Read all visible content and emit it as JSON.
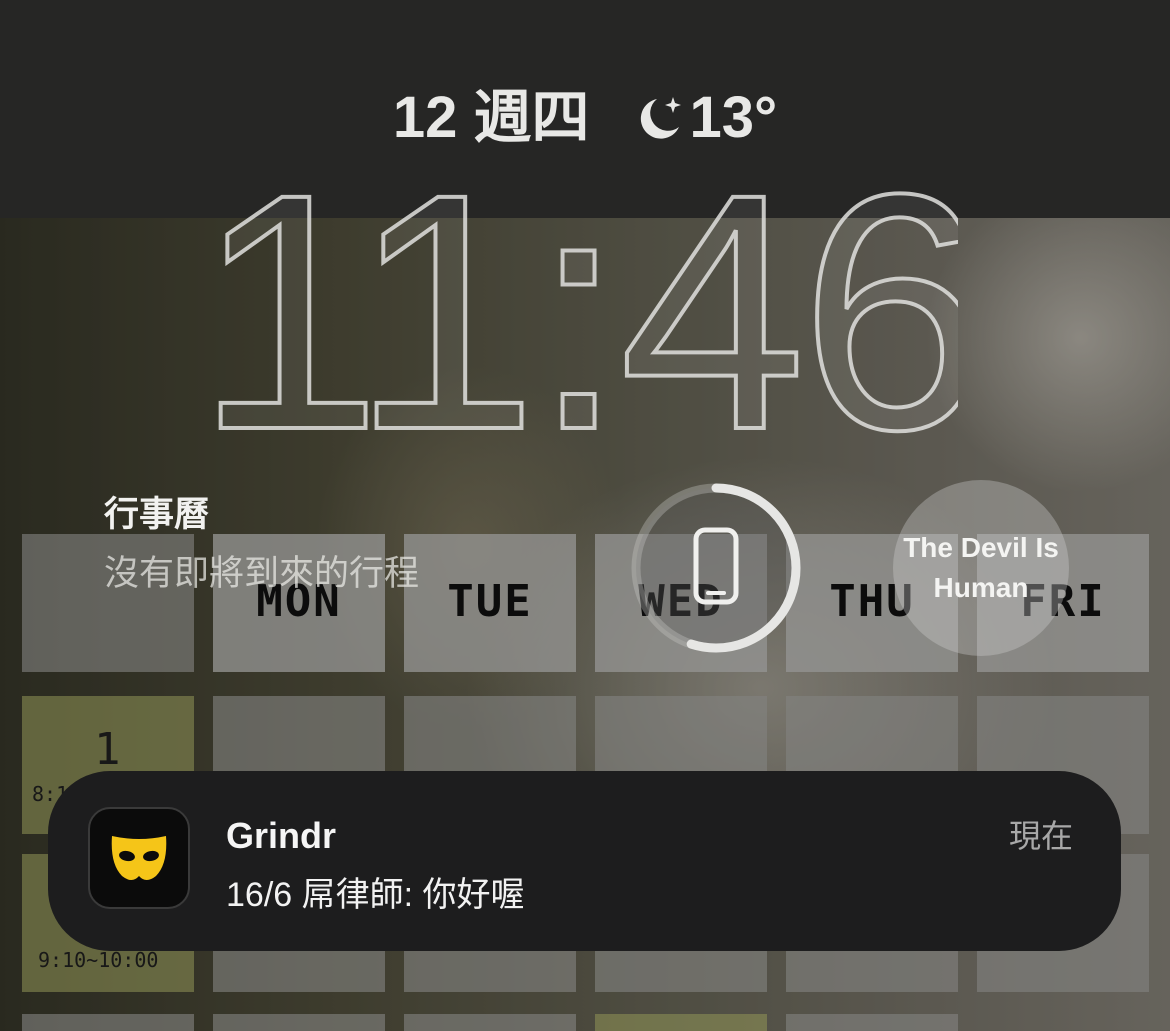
{
  "status": {
    "date": "12 週四",
    "weather_icon": "moon-stars-icon",
    "temperature": "13°"
  },
  "clock": {
    "time": "11:46"
  },
  "calendar_widget": {
    "title": "行事曆",
    "subtitle": "沒有即將到來的行程"
  },
  "battery_widget": {
    "icon": "iphone-icon",
    "level": 0.55
  },
  "music_widget": {
    "title": "The Devil Is Human"
  },
  "wallpaper": {
    "days": [
      "MON",
      "TUE",
      "WED",
      "THU",
      "FRI"
    ],
    "period_number": "1",
    "period_time_top": "8:10",
    "period_time_bottom": "9:10~10:00"
  },
  "notification": {
    "app_icon": "grindr-mask-icon",
    "app": "Grindr",
    "message": "16/6 屌律師: 你好喔",
    "time": "現在"
  },
  "colors": {
    "background": "#262625",
    "notification_bg": "#1d1d1e",
    "grindr_yellow": "#f5c518"
  }
}
